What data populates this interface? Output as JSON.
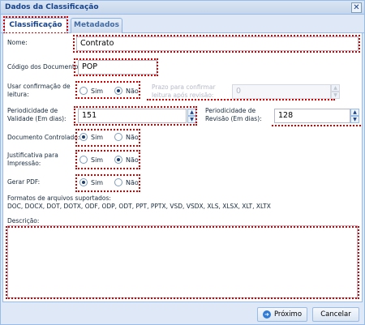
{
  "window": {
    "title": "Dados da Classificação",
    "close_glyph": "✕"
  },
  "tabs": [
    {
      "label": "Classificação",
      "active": true
    },
    {
      "label": "Metadados",
      "active": false
    }
  ],
  "form": {
    "nome": {
      "label": "Nome:",
      "value": "Contrato"
    },
    "codigo": {
      "label": "Código dos Documentos:",
      "value": "POP"
    },
    "confirmacao": {
      "label": "Usar confirmação de leitura:",
      "options": [
        "Sim",
        "Não"
      ],
      "selected": "Não"
    },
    "prazo": {
      "label": "Prazo para confirmar leitura após revisão:",
      "value": "0"
    },
    "validade": {
      "label": "Periodicidade de Validade (Em dias):",
      "value": "151"
    },
    "revisao": {
      "label": "Periodicidade de Revisão (Em dias):",
      "value": "128"
    },
    "controlado": {
      "label": "Documento Controlado:",
      "options": [
        "Sim",
        "Não"
      ],
      "selected": "Sim"
    },
    "justificativa": {
      "label": "Justificativa para Impressão:",
      "options": [
        "Sim",
        "Não"
      ],
      "selected": "Não"
    },
    "pdf": {
      "label": "Gerar PDF:",
      "options": [
        "Sim",
        "Não"
      ],
      "selected": "Sim"
    },
    "formatos": {
      "label": "Formatos de arquivos suportados:",
      "value": "DOC, DOCX, DOT, DOTX, ODF, ODP, ODT, PPT, PPTX, VSD, VSDX, XLS, XLSX, XLT, XLTX"
    },
    "descricao": {
      "label": "Descrição:",
      "value": ""
    }
  },
  "footer": {
    "next_label": "Próximo",
    "cancel_label": "Cancelar"
  },
  "colors": {
    "highlight": "#d10000",
    "accent": "#15428b"
  }
}
